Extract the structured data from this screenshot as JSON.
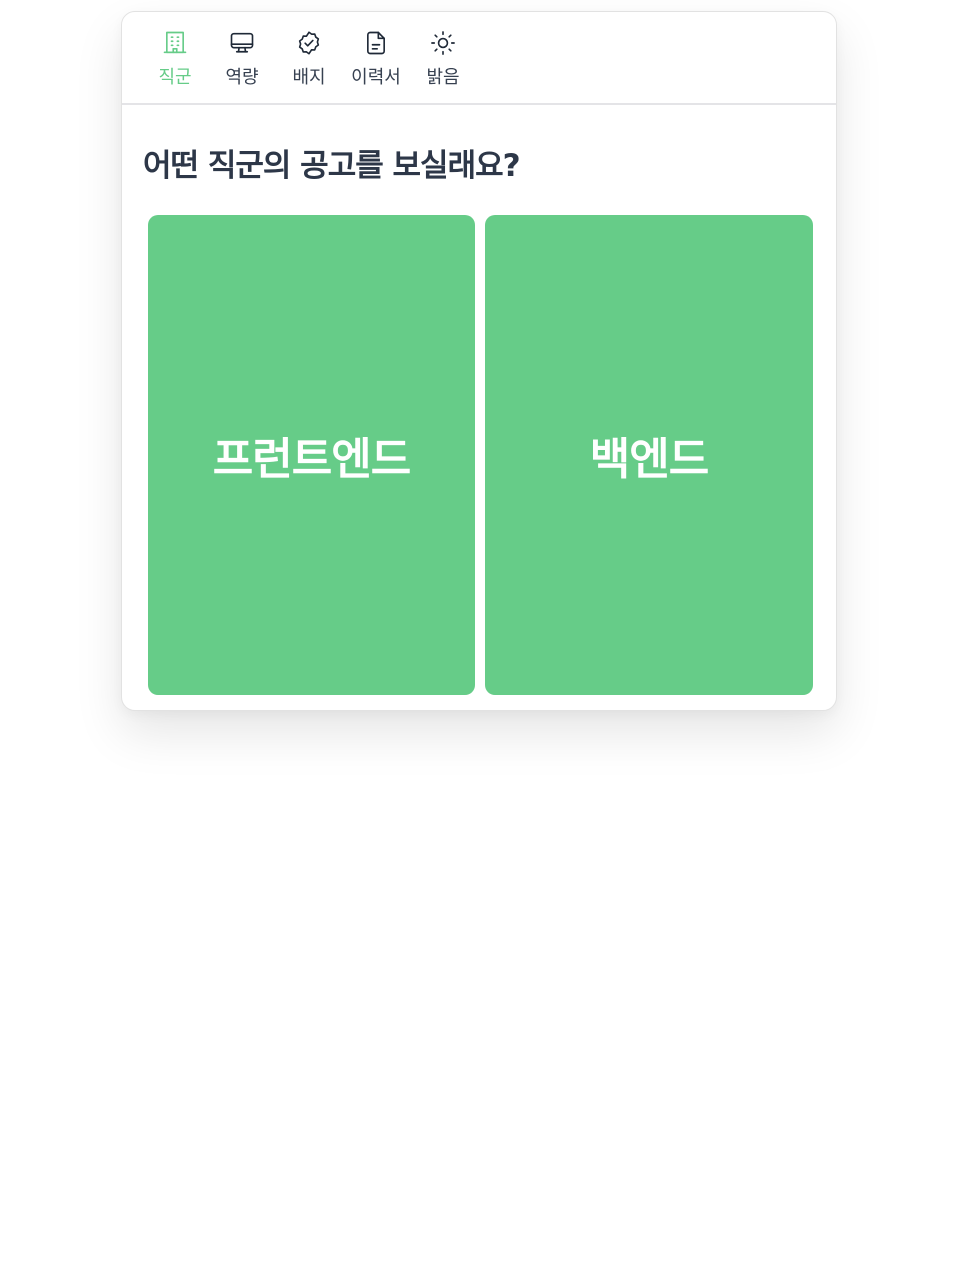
{
  "colors": {
    "accent": "#66cc88",
    "icon_default": "#1f2937",
    "text_dark": "#2d3748",
    "divider": "#e4e4e7"
  },
  "nav": {
    "tabs": [
      {
        "label": "직군",
        "icon": "building-icon",
        "active": true
      },
      {
        "label": "역량",
        "icon": "monitor-icon",
        "active": false
      },
      {
        "label": "배지",
        "icon": "badge-check-icon",
        "active": false
      },
      {
        "label": "이력서",
        "icon": "document-icon",
        "active": false
      },
      {
        "label": "밝음",
        "icon": "sun-icon",
        "active": false
      }
    ]
  },
  "main": {
    "title": "어떤 직군의 공고를 보실래요?",
    "choices": [
      {
        "label": "프런트엔드"
      },
      {
        "label": "백엔드"
      }
    ]
  }
}
